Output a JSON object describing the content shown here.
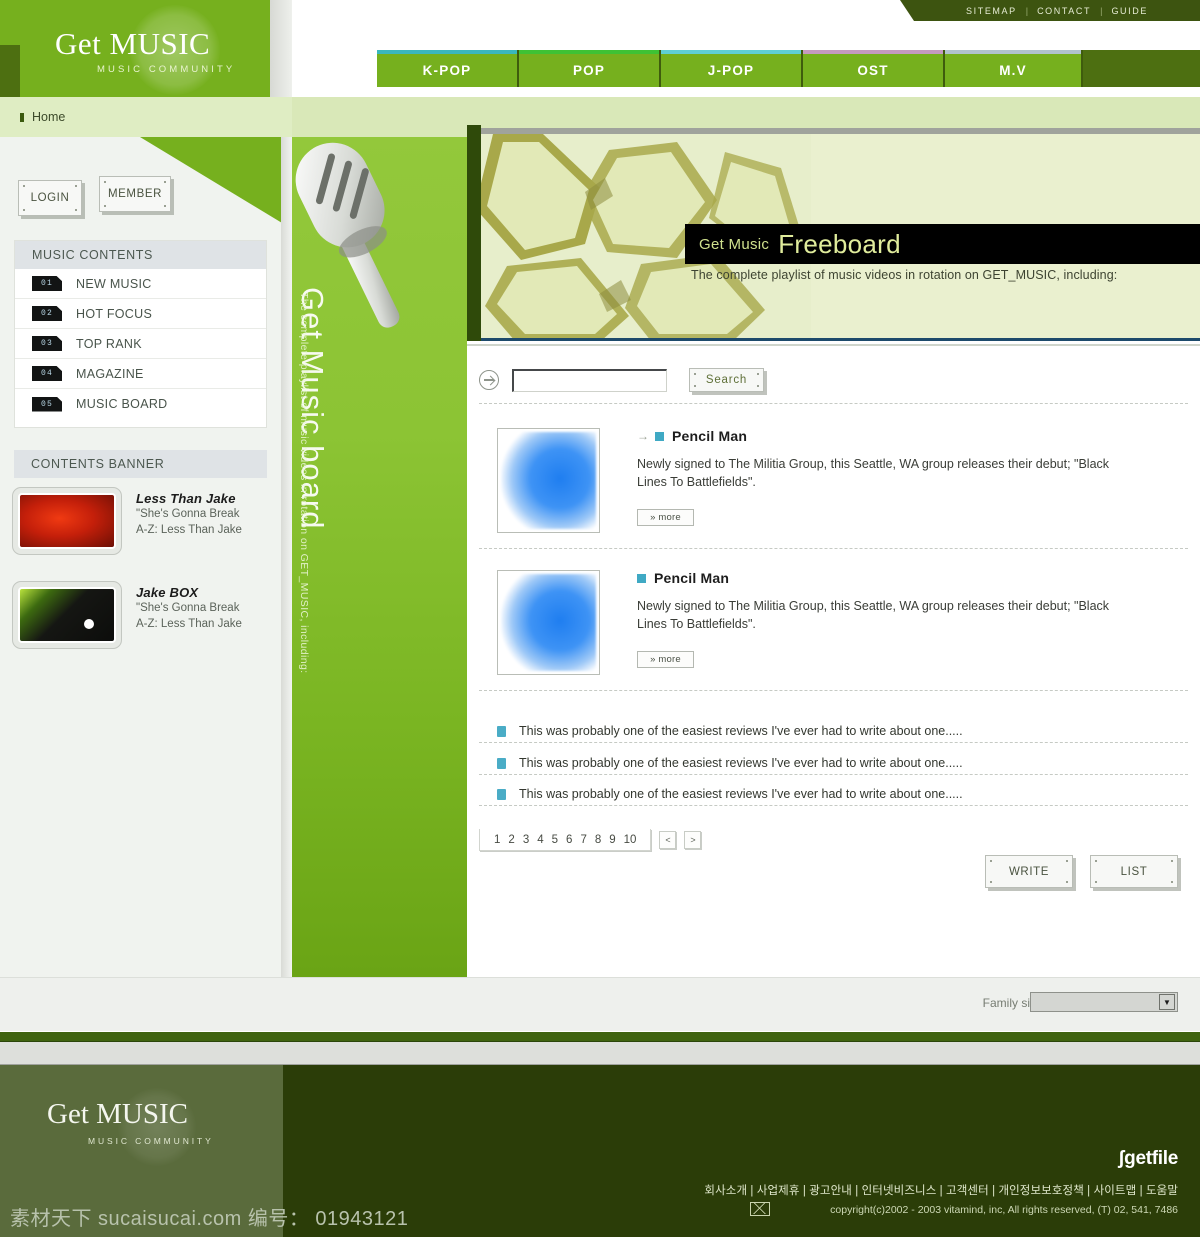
{
  "site": {
    "logo_main": "Get MUSIC",
    "logo_sub": "MUSIC COMMUNITY"
  },
  "topmenu": {
    "items": [
      "SITEMAP",
      "CONTACT",
      "GUIDE"
    ],
    "separator": "|"
  },
  "nav": {
    "tabs": [
      {
        "label": "K-POP",
        "accent": "#3ab7bd"
      },
      {
        "label": "POP",
        "accent": "#3ec234"
      },
      {
        "label": "J-POP",
        "accent": "#5fcfd4"
      },
      {
        "label": "OST",
        "accent": "#c49ac0"
      },
      {
        "label": "M.V",
        "accent": "#b0c3cc"
      }
    ]
  },
  "breadcrumb": {
    "label": "Home"
  },
  "sidebar": {
    "login_label": "LOGIN",
    "member_label": "MEMBER",
    "contents_title": "MUSIC CONTENTS",
    "menu": [
      {
        "num": "01",
        "label": "NEW MUSIC"
      },
      {
        "num": "02",
        "label": "HOT FOCUS"
      },
      {
        "num": "03",
        "label": "TOP RANK"
      },
      {
        "num": "04",
        "label": "MAGAZINE"
      },
      {
        "num": "05",
        "label": "MUSIC BOARD"
      }
    ],
    "banner_title": "CONTENTS BANNER",
    "banners": [
      {
        "title": "Less Than Jake",
        "line1": "\"She's Gonna Break",
        "line2": "A-Z: Less Than Jake"
      },
      {
        "title": "Jake BOX",
        "line1": "\"She's Gonna Break",
        "line2": "A-Z: Less Than Jake"
      }
    ]
  },
  "vertical_panel": {
    "title": "Get Music board",
    "subtitle": "The complete playlist of music videos in rotation on GET_MUSIC, including:"
  },
  "content_banner": {
    "prefix": "Get Music",
    "title": "Freeboard",
    "description": "The complete playlist of music videos in rotation on GET_MUSIC, including:"
  },
  "search": {
    "value": "",
    "placeholder": "",
    "button_label": "Search"
  },
  "articles": [
    {
      "title": "Pencil Man",
      "body": "Newly signed to The Militia Group, this Seattle, WA group releases their debut; \"Black Lines To Battlefields\".",
      "more_label": "» more"
    },
    {
      "title": "Pencil Man",
      "body": "Newly signed to The Militia Group, this Seattle, WA group releases their debut; \"Black Lines To Battlefields\".",
      "more_label": "» more"
    }
  ],
  "list_rows": [
    {
      "text": "This was probably one of the easiest reviews I've ever had to write about one....."
    },
    {
      "text": "This was probably one of the easiest reviews I've ever had to write about one....."
    },
    {
      "text": "This was probably one of the easiest reviews I've ever had to write about one....."
    }
  ],
  "pagination": {
    "pages": [
      "1",
      "2",
      "3",
      "4",
      "5",
      "6",
      "7",
      "8",
      "9",
      "10"
    ],
    "prev_label": "<",
    "next_label": ">"
  },
  "actions": {
    "write_label": "WRITE",
    "list_label": "LIST"
  },
  "family_site": {
    "label": "Family site",
    "selected": "",
    "arrow": "▼"
  },
  "footer": {
    "logo_main": "Get MUSIC",
    "logo_sub": "MUSIC COMMUNITY",
    "getfile_brand": "getfile",
    "links": "회사소개 | 사업제휴 | 광고안내 | 인터넷비즈니스 | 고객센터 | 개인정보보호정책 | 사이트맵 | 도움말",
    "copyright": "copyright(c)2002 - 2003 vitamind, inc,  All rights reserved, (T) 02, 541, 7486"
  },
  "watermark": {
    "text": "素材天下 sucaisucai.com  编号： 01943121"
  }
}
